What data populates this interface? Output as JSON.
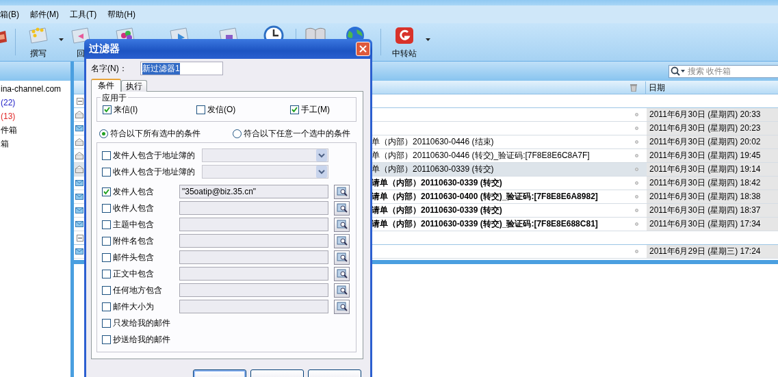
{
  "menu": [
    {
      "label": "箱(B)"
    },
    {
      "label": "邮件(M)"
    },
    {
      "label": "工具(T)"
    },
    {
      "label": "帮助(H)"
    }
  ],
  "toolbar": [
    {
      "kind": "edge"
    },
    {
      "kind": "separator"
    },
    {
      "kind": "compose",
      "label": "撰写",
      "dropdown": true
    },
    {
      "kind": "reply",
      "label": "回"
    },
    {
      "kind": "contacts"
    },
    {
      "kind": "forward"
    },
    {
      "kind": "move"
    },
    {
      "kind": "clock"
    },
    {
      "kind": "separator"
    },
    {
      "kind": "book"
    },
    {
      "kind": "globe"
    },
    {
      "kind": "separator"
    },
    {
      "kind": "relay",
      "label": "中转站",
      "dropdown": true
    }
  ],
  "folders": [
    {
      "label": "ina-channel.com"
    },
    {
      "label": "(22)",
      "color": "#2020c8"
    },
    {
      "label": "(13)",
      "color": "#e02828"
    },
    {
      "label": "件箱"
    },
    {
      "label": "箱"
    }
  ],
  "search": {
    "placeholder": "搜索 收件箱"
  },
  "list": {
    "date_header": "日期",
    "groups": [
      {
        "expanded": true,
        "messages": [
          {
            "date": "2011年6月30日 (星期四) 20:33",
            "unread": false,
            "selected": false
          },
          {
            "date": "2011年6月30日 (星期四) 20:23",
            "unread": true,
            "selected": false
          },
          {
            "subject": "单（内部）20110630-0446 (结束)",
            "date": "2011年6月30日 (星期四) 20:02",
            "unread": false,
            "selected": false
          },
          {
            "subject": "单（内部）20110630-0446 (转交)_验证码:[7F8E8E6C8A7F]",
            "date": "2011年6月30日 (星期四) 19:45",
            "unread": false,
            "selected": false
          },
          {
            "subject": "单（内部）20110630-0339 (转交)",
            "date": "2011年6月30日 (星期四) 19:14",
            "unread": false,
            "selected": true
          },
          {
            "subject": "请单（内部）20110630-0339 (转交)",
            "date": "2011年6月30日 (星期四) 18:42",
            "unread": true,
            "selected": false
          },
          {
            "subject": "请单（内部）20110630-0400 (转交)_验证码:[7F8E8E6A8982]",
            "date": "2011年6月30日 (星期四) 18:38",
            "unread": true,
            "selected": false
          },
          {
            "subject": "请单（内部）20110630-0339 (转交)",
            "date": "2011年6月30日 (星期四) 18:37",
            "unread": true,
            "selected": false
          },
          {
            "subject": "请单（内部）20110630-0339 (转交)_验证码:[7F8E8E688C81]",
            "date": "2011年6月30日 (星期四) 17:34",
            "unread": true,
            "selected": false
          }
        ]
      },
      {
        "expanded": true,
        "messages": [
          {
            "date": "2011年6月29日 (星期三) 17:24",
            "unread": true,
            "selected": false
          }
        ]
      }
    ]
  },
  "dialog": {
    "title": "过滤器",
    "name_label": "名字(N)：",
    "name_value": "新过滤器1",
    "name_highlighted": true,
    "tabs": [
      {
        "label": "条件",
        "selected": true
      },
      {
        "label": "执行",
        "selected": false
      }
    ],
    "apply_to": {
      "legend": "应用于",
      "options": [
        {
          "label": "来信(I)",
          "checked": true
        },
        {
          "label": "发信(O)",
          "checked": false
        },
        {
          "label": "手工(M)",
          "checked": true
        }
      ]
    },
    "match": [
      {
        "label": "符合以下所有选中的条件",
        "selected": true
      },
      {
        "label": "符合以下任意一个选中的条件",
        "selected": false
      }
    ],
    "conditions": [
      {
        "kind": "dropdown",
        "label": "发件人包含于地址簿的",
        "checked": false
      },
      {
        "kind": "dropdown",
        "label": "收件人包含于地址簿的",
        "checked": false
      },
      {
        "kind": "text",
        "label": "发件人包含",
        "checked": true,
        "value": "\"35oatip@biz.35.cn\""
      },
      {
        "kind": "text",
        "label": "收件人包含",
        "checked": false
      },
      {
        "kind": "text",
        "label": "主题中包含",
        "checked": false
      },
      {
        "kind": "text",
        "label": "附件名包含",
        "checked": false
      },
      {
        "kind": "text",
        "label": "邮件头包含",
        "checked": false
      },
      {
        "kind": "text",
        "label": "正文中包含",
        "checked": false
      },
      {
        "kind": "text",
        "label": "任何地方包含",
        "checked": false
      },
      {
        "kind": "text",
        "label": "邮件大小为",
        "checked": false
      },
      {
        "kind": "plain",
        "label": "只发给我的邮件",
        "checked": false
      },
      {
        "kind": "plain",
        "label": "抄送给我的邮件",
        "checked": false
      }
    ],
    "buttons": [
      {
        "default": true
      },
      {
        "default": false
      },
      {
        "default": false
      }
    ]
  }
}
